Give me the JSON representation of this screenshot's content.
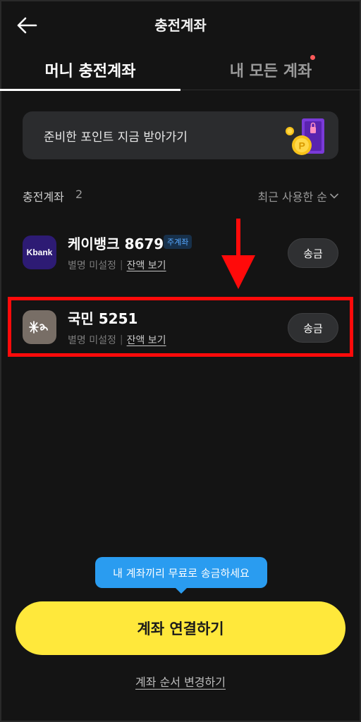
{
  "header": {
    "title": "충전계좌"
  },
  "tabs": [
    {
      "label": "머니 충전계좌",
      "active": true
    },
    {
      "label": "내 모든 계좌",
      "active": false,
      "has_dot": true
    }
  ],
  "promo": {
    "text": "준비한 포인트 지금 받아가기"
  },
  "accounts_section": {
    "label": "충전계좌",
    "count": "2",
    "sort_label": "최근 사용한 순"
  },
  "accounts": [
    {
      "bank_logo_text": "Kbank",
      "name": "케이뱅크 8679",
      "badge": "주계좌",
      "alias": "별명 미설정",
      "balance_link": "잔액 보기",
      "send_label": "송금"
    },
    {
      "name": "국민 5251",
      "alias": "별명 미설정",
      "balance_link": "잔액 보기",
      "send_label": "송금"
    }
  ],
  "tooltip": {
    "text": "내 계좌끼리 무료로 송금하세요"
  },
  "connect_button": {
    "label": "계좌 연결하기"
  },
  "reorder_link": {
    "label": "계좌 순서 변경하기"
  },
  "colors": {
    "background": "#141414",
    "primary_yellow": "#ffe83b",
    "tooltip_blue": "#2a9cf0",
    "highlight_red": "#ff0a0a",
    "kbank_purple": "#2d1b74",
    "kb_brown": "#786e66",
    "badge_blue": "#57a8ff"
  }
}
